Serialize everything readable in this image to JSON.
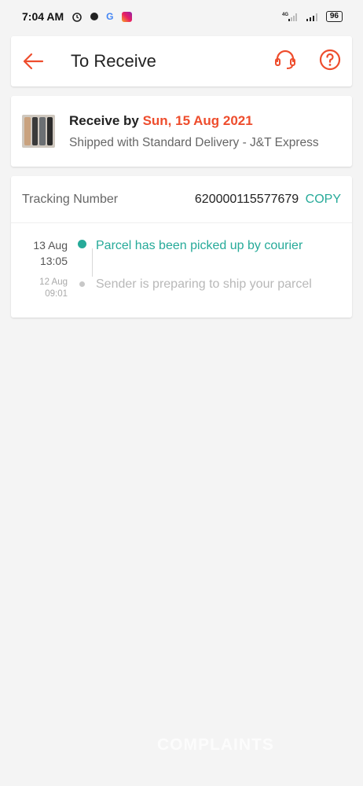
{
  "status_bar": {
    "time": "7:04 AM",
    "network": "4G",
    "battery": "96",
    "icons": [
      "alarm-icon",
      "dot-icon",
      "google-icon",
      "instagram-icon",
      "signal-icon",
      "wifi-icon",
      "battery-icon"
    ]
  },
  "header": {
    "title": "To Receive",
    "back_icon": "arrow-left-icon",
    "support_icon": "headset-icon",
    "help_icon": "question-circle-icon"
  },
  "delivery": {
    "receive_prefix": "Receive by ",
    "receive_date": "Sun, 15 Aug 2021",
    "shipped_text": "Shipped with Standard Delivery  - J&T Express"
  },
  "tracking": {
    "label": "Tracking Number",
    "number": "620000115577679",
    "copy_label": "COPY",
    "events": [
      {
        "date": "13 Aug",
        "time": "13:05",
        "text": "Parcel has been picked up by courier",
        "active": true
      },
      {
        "date": "12 Aug",
        "time": "09:01",
        "text": "Sender is preparing to ship your parcel",
        "active": false
      }
    ]
  },
  "watermark": "COMPLAINTS",
  "colors": {
    "accent": "#ee4d2d",
    "teal": "#26aa99",
    "background": "#f4f4f4"
  }
}
